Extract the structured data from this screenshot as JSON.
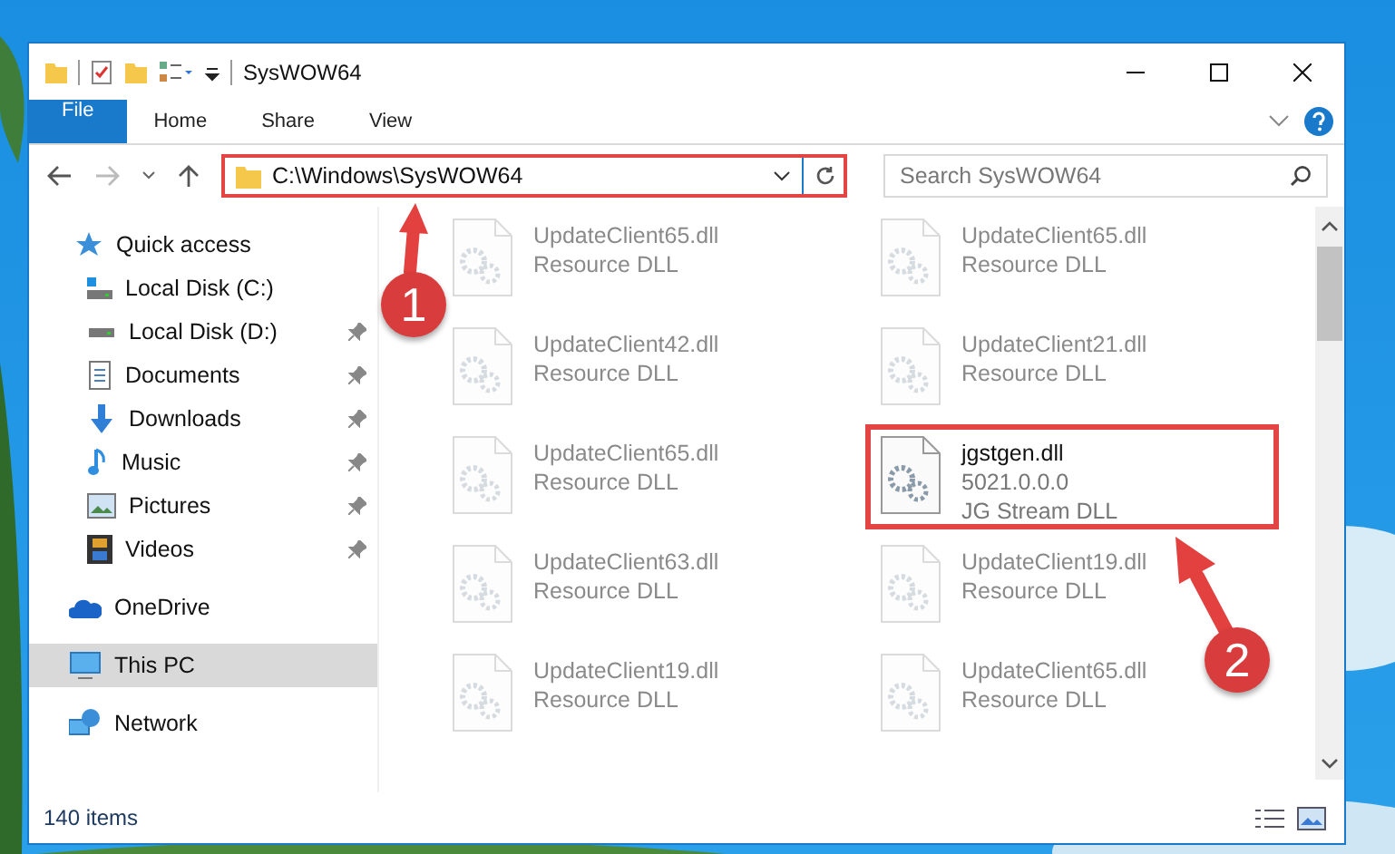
{
  "window": {
    "title": "SysWOW64"
  },
  "ribbon_tabs": [
    {
      "label": "File",
      "kind": "file"
    },
    {
      "label": "Home",
      "kind": "tab"
    },
    {
      "label": "Share",
      "kind": "tab"
    },
    {
      "label": "View",
      "kind": "tab"
    }
  ],
  "address_bar": {
    "path": "C:\\Windows\\SysWOW64"
  },
  "search": {
    "placeholder": "Search SysWOW64"
  },
  "sidebar": {
    "items": [
      {
        "label": "Quick access",
        "kind": "star",
        "selected": false,
        "children": [
          {
            "label": "Local Disk (C:)",
            "kind": "system-drive",
            "pinned": false,
            "selected": false
          },
          {
            "label": "Local Disk (D:)",
            "kind": "drive",
            "pinned": true,
            "selected": false
          },
          {
            "label": "Documents",
            "kind": "documents",
            "pinned": true,
            "selected": false
          },
          {
            "label": "Downloads",
            "kind": "downloads",
            "pinned": true,
            "selected": false
          },
          {
            "label": "Music",
            "kind": "music",
            "pinned": true,
            "selected": false
          },
          {
            "label": "Pictures",
            "kind": "pictures",
            "pinned": true,
            "selected": false
          },
          {
            "label": "Videos",
            "kind": "videos",
            "pinned": true,
            "selected": false
          }
        ]
      },
      {
        "label": "OneDrive",
        "kind": "cloud",
        "selected": false
      },
      {
        "label": "This PC",
        "kind": "pc",
        "selected": true
      },
      {
        "label": "Network",
        "kind": "network",
        "selected": false
      }
    ]
  },
  "files": [
    {
      "name": "UpdateClient65.dll",
      "lines": [
        "Resource DLL"
      ],
      "faded": true
    },
    {
      "name": "UpdateClient65.dll",
      "lines": [
        "Resource DLL"
      ],
      "faded": true
    },
    {
      "name": "UpdateClient42.dll",
      "lines": [
        "Resource DLL"
      ],
      "faded": true
    },
    {
      "name": "UpdateClient21.dll",
      "lines": [
        "Resource DLL"
      ],
      "faded": true
    },
    {
      "name": "UpdateClient65.dll",
      "lines": [
        "Resource DLL"
      ],
      "faded": true
    },
    {
      "name": "jgstgen.dll",
      "lines": [
        "5021.0.0.0",
        "JG Stream DLL"
      ],
      "faded": false
    },
    {
      "name": "UpdateClient63.dll",
      "lines": [
        "Resource DLL"
      ],
      "faded": true
    },
    {
      "name": "UpdateClient19.dll",
      "lines": [
        "Resource DLL"
      ],
      "faded": true
    },
    {
      "name": "UpdateClient19.dll",
      "lines": [
        "Resource DLL"
      ],
      "faded": true
    },
    {
      "name": "UpdateClient65.dll",
      "lines": [
        "Resource DLL"
      ],
      "faded": true
    }
  ],
  "status_bar": {
    "item_count": "140 items"
  },
  "annotations": [
    {
      "label": "1"
    },
    {
      "label": "2"
    }
  ]
}
